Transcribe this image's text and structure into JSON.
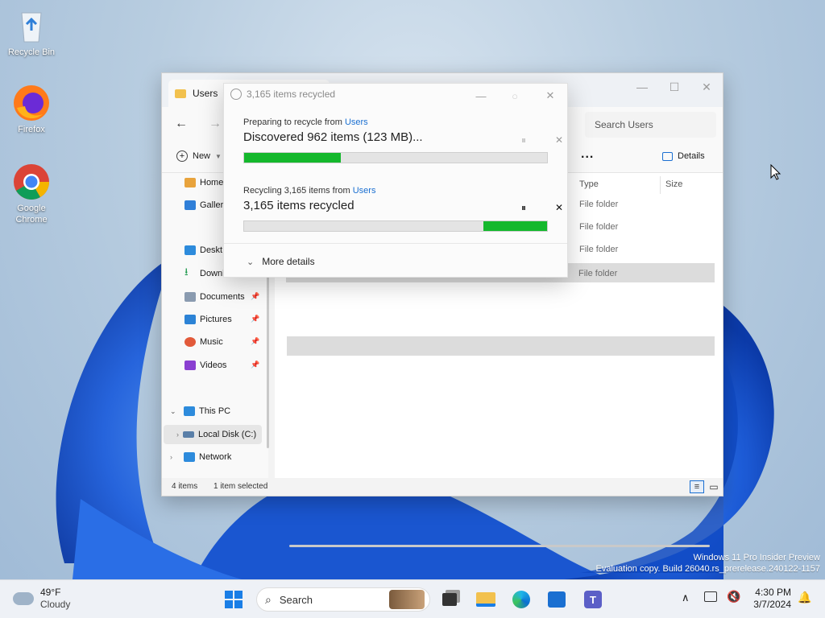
{
  "desktop": {
    "icons": [
      {
        "label": "Recycle Bin"
      },
      {
        "label": "Firefox"
      },
      {
        "label": "Google Chrome"
      }
    ],
    "watermark_line1": "Windows 11 Pro Insider Preview",
    "watermark_line2": "Evaluation copy. Build 26040.rs_prerelease.240122-1157"
  },
  "explorer": {
    "tab_title": "Users",
    "search_placeholder": "Search Users",
    "new_label": "New",
    "details_label": "Details",
    "more_label": "...",
    "nav_items": [
      {
        "label": "Home",
        "icon": "home-icon",
        "color": "#e8a33c"
      },
      {
        "label": "Galler",
        "icon": "gallery-icon",
        "color": "#2f7fd8"
      },
      {
        "label": "Deskt",
        "icon": "desktop-icon",
        "color": "#2d8bdc"
      },
      {
        "label": "Downloads",
        "icon": "download-icon",
        "color": "#1f9a4e"
      },
      {
        "label": "Documents",
        "icon": "documents-icon",
        "color": "#8a9bb0"
      },
      {
        "label": "Pictures",
        "icon": "pictures-icon",
        "color": "#2c83d6"
      },
      {
        "label": "Music",
        "icon": "music-icon",
        "color": "#e25a3a"
      },
      {
        "label": "Videos",
        "icon": "videos-icon",
        "color": "#8a3fd1"
      },
      {
        "label": "This PC",
        "icon": "pc-icon",
        "color": "#2d8bdc"
      },
      {
        "label": "Local Disk (C:)",
        "icon": "disk-icon",
        "color": "#5a7fa8"
      },
      {
        "label": "Network",
        "icon": "network-icon",
        "color": "#2d8bdc"
      }
    ],
    "columns": {
      "type": "Type",
      "size": "Size"
    },
    "rows": [
      {
        "type": "File folder"
      },
      {
        "type": "File folder"
      },
      {
        "type": "File folder"
      },
      {
        "type": "File folder"
      }
    ],
    "status": {
      "items": "4 items",
      "selected": "1 item selected"
    }
  },
  "dialog": {
    "title": "3,165 items recycled",
    "op1": {
      "prefix": "Preparing to recycle from ",
      "link": "Users",
      "main": "Discovered 962 items (123 MB)...",
      "progress": 0.32
    },
    "op2": {
      "prefix": "Recycling 3,165 items from ",
      "link": "Users",
      "main": "3,165 items recycled",
      "progress": 0.21
    },
    "more_details": "More details"
  },
  "taskbar": {
    "weather_temp": "49°F",
    "weather_desc": "Cloudy",
    "search_label": "Search",
    "time": "4:30 PM",
    "date": "3/7/2024"
  }
}
